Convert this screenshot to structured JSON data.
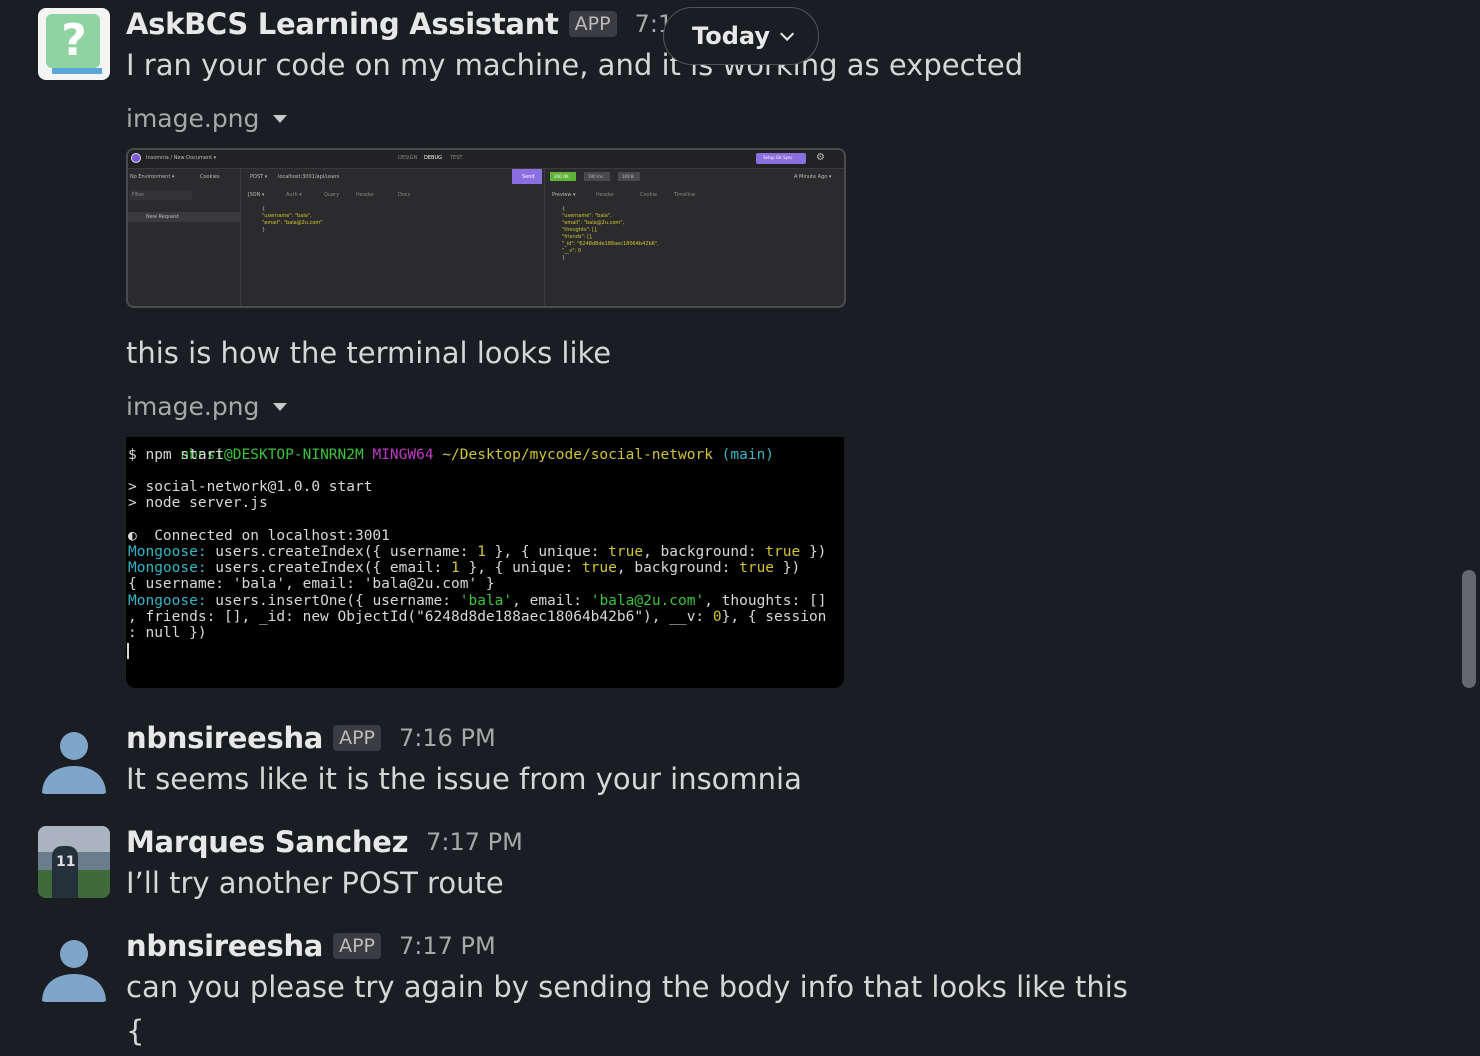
{
  "date_divider": {
    "label": "Today"
  },
  "messages": [
    {
      "author": "AskBCS Learning Assistant",
      "badge": "APP",
      "time": "7:15 PM",
      "text": "I ran your code on my machine, and it is working as expected",
      "attachment1_label": "image.png",
      "text2": "this is how the terminal looks like",
      "attachment2_label": "image.png"
    },
    {
      "author": "nbnsireesha",
      "badge": "APP",
      "time": "7:16 PM",
      "text": "It seems like it is the issue from your insomnia"
    },
    {
      "author": "Marques Sanchez",
      "time": "7:17 PM",
      "text": "I’ll try another POST route"
    },
    {
      "author": "nbnsireesha",
      "badge": "APP",
      "time": "7:17 PM",
      "text": "can you please try again by sending the body  info that looks like this",
      "text2": "{"
    }
  ],
  "insomnia": {
    "breadcrumb": "Insomnia / New Document ▾",
    "tabs": [
      "DESIGN",
      "DEBUG",
      "TEST"
    ],
    "sync": "Setup Git Sync",
    "environment": "No Environment ▾",
    "cookies": "Cookies",
    "filter": "Filter",
    "request_item": "New Request",
    "method": "POST ▾",
    "url": "localhost:3001/api/users",
    "send": "Send",
    "status": "200 OK",
    "duration": "190 ms",
    "size": "109 B",
    "when": "A Minute Ago ▾",
    "req_tabs": [
      "JSON ▾",
      "Auth ▾",
      "Query",
      "Header",
      "Docs"
    ],
    "res_tabs": [
      "Preview ▾",
      "Header",
      "Cookie",
      "Timeline"
    ],
    "req_body": [
      "{",
      "  \"username\": \"bala\",",
      "  \"email\": \"bala@2u.com\"",
      "}"
    ],
    "res_body": [
      "{",
      "  \"username\": \"bala\",",
      "  \"email\": \"bala@2u.com\",",
      "  \"thoughts\": [],",
      "  \"friends\": [],",
      "  \"_id\": \"6248d8de188aec18064b42b6\",",
      "  \"__v\": 0",
      "}"
    ]
  },
  "terminal": {
    "prompt_user": "nbnsi@DESKTOP-NINRN2M",
    "prompt_env": "MINGW64",
    "prompt_path": "~/Desktop/mycode/social-network",
    "prompt_branch": "(main)",
    "cmd": "$ npm start",
    "start1": "> social-network@1.0.0 start",
    "start2": "> node server.js",
    "connected": "  Connected on localhost:3001",
    "mongoose_label": "Mongoose:",
    "idx1_a": " users.createIndex({ username: ",
    "idx1_n": "1",
    "idx1_b": " }, { unique: ",
    "idx1_t1": "true",
    "idx1_c": ", background: ",
    "idx1_t2": "true",
    "idx1_d": " })",
    "idx2_a": " users.createIndex({ email: ",
    "idx2_n": "1",
    "idx2_b": " }, { unique: ",
    "idx2_t1": "true",
    "idx2_c": ", background: ",
    "idx2_t2": "true",
    "idx2_d": " })",
    "body_line": "{ username: 'bala', email: 'bala@2u.com' }",
    "ins_a": " users.insertOne({ username: ",
    "ins_u": "'bala'",
    "ins_b": ", email: ",
    "ins_e": "'bala@2u.com'",
    "ins_c": ", thoughts: []",
    "ins_line2_a": ", friends: [], _id: new ObjectId(\"6248d8de188aec18064b42b6\"), __v: ",
    "ins_line2_n": "0",
    "ins_line2_b": "}, { session",
    "ins_line3": ": null })"
  },
  "colors": {
    "background": "#1a1d21",
    "terminal_green": "#39c43c",
    "terminal_cyan": "#34b4c8",
    "terminal_yellow": "#d2c432",
    "terminal_magenta": "#c038c6",
    "send_purple": "#8a6fe0"
  }
}
